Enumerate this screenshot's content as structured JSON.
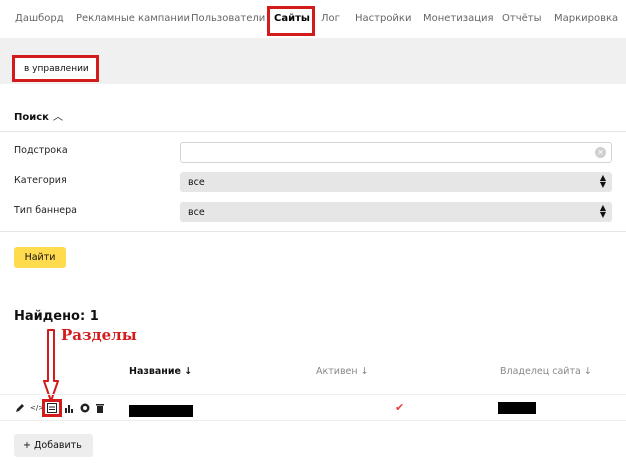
{
  "nav": {
    "items": [
      "Дашборд",
      "Рекламные кампании",
      "Пользователи",
      "Сайты",
      "Лог",
      "Настройки",
      "Монетизация",
      "Отчёты",
      "Маркировка"
    ],
    "active": "Сайты"
  },
  "subtabs": {
    "active_label": "в управлении"
  },
  "search": {
    "title": "Поиск",
    "substring_label": "Подстрока",
    "substring_value": "",
    "category_label": "Категория",
    "category_value": "все",
    "banner_type_label": "Тип баннера",
    "banner_type_value": "все",
    "find_label": "Найти"
  },
  "results": {
    "found_text": "Найдено: 1",
    "annotation": "Разделы",
    "columns": [
      "Название ↓",
      "Активен ↓",
      "Владелец сайта ↓"
    ],
    "row": {
      "active": true
    }
  },
  "add_label": "+ Добавить",
  "colors": {
    "accent_yellow": "#ffdb4d",
    "annotation_red": "#d41b1b",
    "check_red": "#e8413c"
  }
}
